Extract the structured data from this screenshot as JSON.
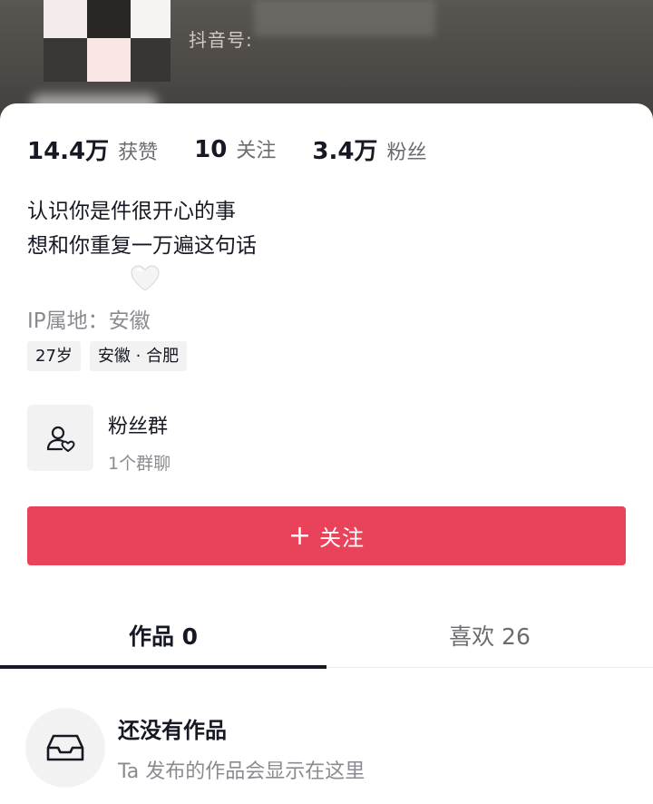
{
  "header": {
    "douyin_id_label": "抖音号:"
  },
  "stats": [
    {
      "value": "14.4万",
      "label": "获赞"
    },
    {
      "value": "10",
      "label": "关注"
    },
    {
      "value": "3.4万",
      "label": "粉丝"
    }
  ],
  "bio": {
    "line1": "认识你是件很开心的事",
    "line2": "想和你重复一万遍这句话"
  },
  "ip_location": "IP属地：安徽",
  "tags": [
    "27岁",
    "安徽 · 合肥"
  ],
  "fan_group": {
    "title": "粉丝群",
    "subtitle": "1个群聊"
  },
  "follow_button": {
    "plus": "+",
    "label": "关注"
  },
  "tabs": [
    {
      "label": "作品 0"
    },
    {
      "label": "喜欢 26"
    }
  ],
  "empty_state": {
    "title": "还没有作品",
    "subtitle": "Ta 发布的作品会显示在这里"
  },
  "colors": {
    "accent": "#e8435a",
    "text_primary": "#161823",
    "text_secondary": "#8a8b91"
  }
}
